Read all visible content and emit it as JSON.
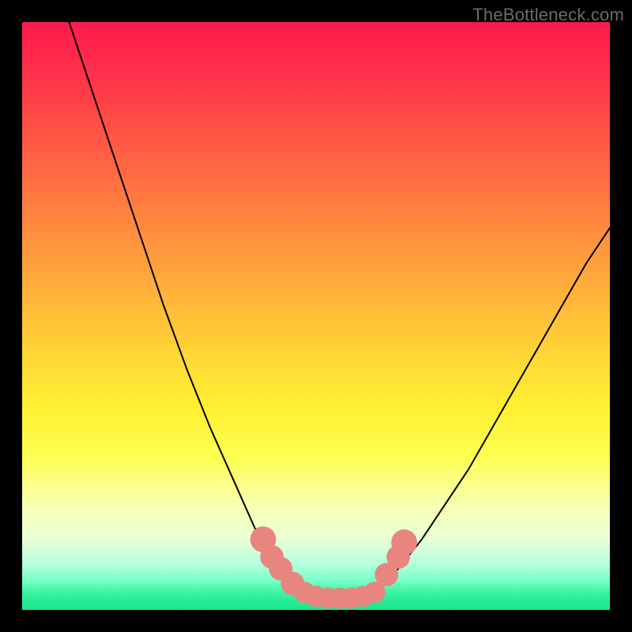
{
  "watermark": {
    "text": "TheBottleneck.com"
  },
  "chart_data": {
    "type": "line",
    "title": "",
    "xlabel": "",
    "ylabel": "",
    "xlim": [
      0,
      100
    ],
    "ylim": [
      0,
      100
    ],
    "grid": false,
    "legend": null,
    "series": [
      {
        "name": "left-curve",
        "x": [
          8,
          12,
          16,
          20,
          24,
          28,
          32,
          36,
          40,
          42,
          44,
          46,
          48
        ],
        "y": [
          100,
          88,
          76,
          64,
          52,
          41,
          31,
          22,
          13,
          9,
          6,
          4,
          3
        ],
        "stroke": "#000000",
        "stroke_width": 2
      },
      {
        "name": "floor",
        "x": [
          48,
          50,
          52,
          54,
          56,
          58,
          60
        ],
        "y": [
          3,
          2,
          2,
          2,
          2,
          2,
          3
        ],
        "stroke": "#000000",
        "stroke_width": 2
      },
      {
        "name": "right-curve",
        "x": [
          60,
          64,
          68,
          72,
          76,
          80,
          84,
          88,
          92,
          96,
          100
        ],
        "y": [
          3,
          7,
          12,
          18,
          24,
          31,
          38,
          45,
          52,
          59,
          65
        ],
        "stroke": "#000000",
        "stroke_width": 2
      }
    ],
    "markers": [
      {
        "x": 41,
        "y": 12,
        "r": 2.2,
        "fill": "#e8857f"
      },
      {
        "x": 42.5,
        "y": 9,
        "r": 2.0,
        "fill": "#e8857f"
      },
      {
        "x": 44,
        "y": 7,
        "r": 2.0,
        "fill": "#e8857f"
      },
      {
        "x": 46,
        "y": 4.5,
        "r": 2.0,
        "fill": "#e8857f"
      },
      {
        "x": 48,
        "y": 3,
        "r": 1.8,
        "fill": "#e8857f"
      },
      {
        "x": 50,
        "y": 2.3,
        "r": 1.8,
        "fill": "#e8857f"
      },
      {
        "x": 52,
        "y": 2,
        "r": 1.8,
        "fill": "#e8857f"
      },
      {
        "x": 54,
        "y": 2,
        "r": 1.8,
        "fill": "#e8857f"
      },
      {
        "x": 56,
        "y": 2,
        "r": 1.8,
        "fill": "#e8857f"
      },
      {
        "x": 58,
        "y": 2.3,
        "r": 1.8,
        "fill": "#e8857f"
      },
      {
        "x": 60,
        "y": 3,
        "r": 1.8,
        "fill": "#e8857f"
      },
      {
        "x": 62,
        "y": 6,
        "r": 2.0,
        "fill": "#e8857f"
      },
      {
        "x": 64,
        "y": 9,
        "r": 2.0,
        "fill": "#e8857f"
      },
      {
        "x": 65,
        "y": 11.5,
        "r": 2.2,
        "fill": "#e8857f"
      }
    ],
    "gradient_stops": [
      {
        "offset": 0,
        "color": "#ff1a4d"
      },
      {
        "offset": 26,
        "color": "#ff6b42"
      },
      {
        "offset": 56,
        "color": "#ffd436"
      },
      {
        "offset": 82,
        "color": "#f8ffb0"
      },
      {
        "offset": 100,
        "color": "#17e58c"
      }
    ]
  }
}
